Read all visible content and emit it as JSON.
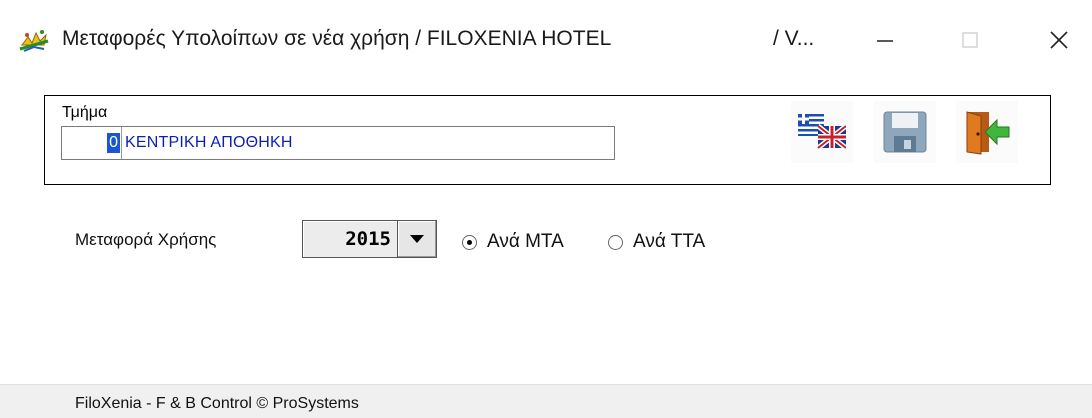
{
  "window": {
    "title": "Μεταφορές Υπολοίπων σε νέα χρήση / FILOXENIA HOTEL",
    "title_suffix": "/ V...",
    "icon": "sparkle-app-icon",
    "controls": [
      "minimize-icon",
      "maximize-icon",
      "close-icon"
    ]
  },
  "section": {
    "label": "Τμήμα",
    "code": "0",
    "name": "ΚΕΝΤΡΙΚΗ ΑΠΟΘΗΚΗ"
  },
  "toolbar": {
    "buttons": [
      "flags-language-icon",
      "floppy-save-icon",
      "door-exit-icon"
    ]
  },
  "year": {
    "label": "Μεταφορά Χρήσης",
    "value": "2015"
  },
  "options": {
    "mta_label": "Ανά ΜΤΑ",
    "tta_label": "Ανά ΤΤΑ",
    "selected": "mta"
  },
  "status": {
    "text": "FiloXenia - F & B Control  © ProSystems"
  },
  "colors": {
    "selection": "#1a55d8",
    "field_text": "#0b1fb4",
    "statusbar": "#f0f0f0"
  }
}
